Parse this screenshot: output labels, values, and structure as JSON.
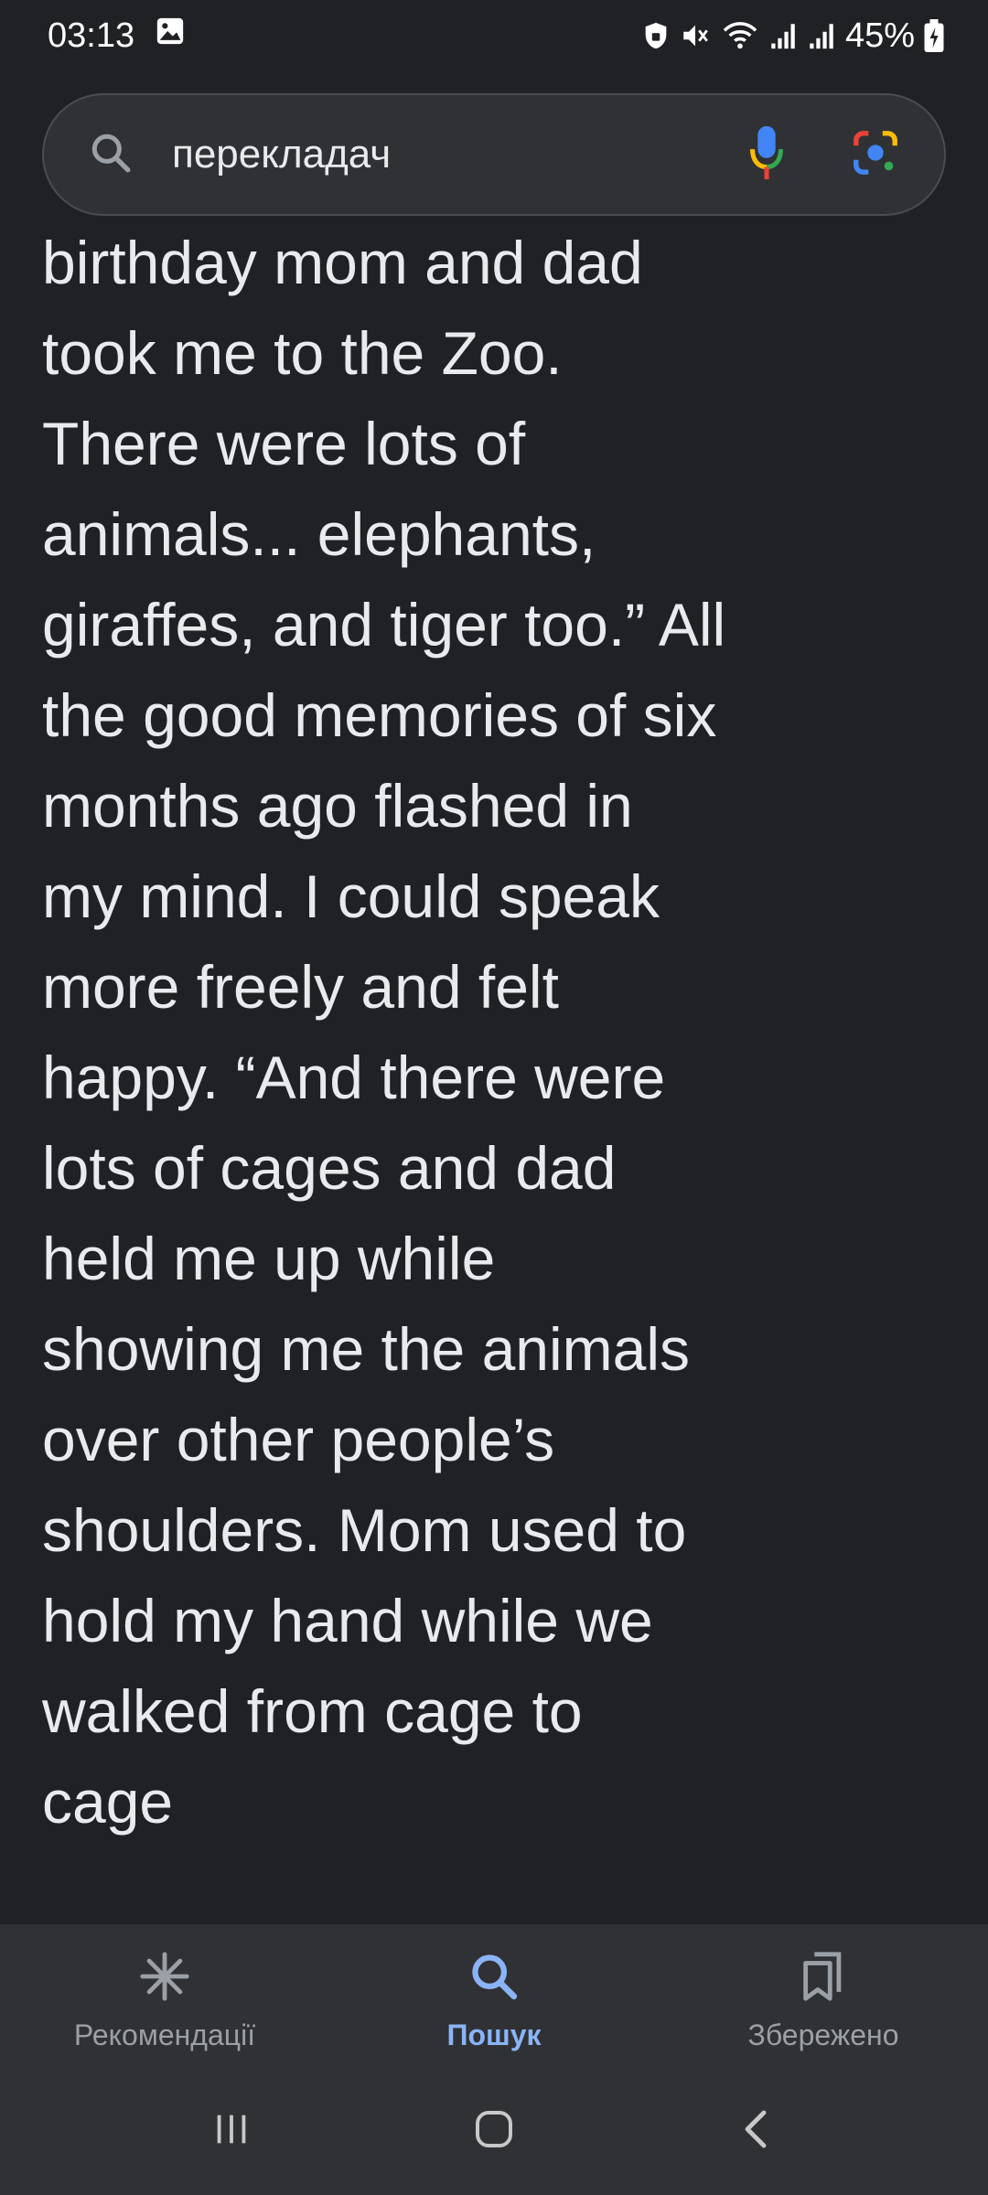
{
  "status_bar": {
    "time": "03:13",
    "battery": "45%",
    "icons": [
      "image-icon",
      "vpn-lock-icon",
      "mute-icon",
      "wifi-icon",
      "signal-icon",
      "signal-icon",
      "battery-charging-icon"
    ]
  },
  "search": {
    "query": "перекладач",
    "icons": [
      "search-icon",
      "mic-icon",
      "lens-icon"
    ]
  },
  "article": {
    "lines": [
      "birthday mom and dad",
      "took me to the Zoo.",
      "There were lots of",
      "animals... elephants,",
      "giraffes, and tiger too.” All",
      "the good memories of six",
      "months ago flashed in",
      "my mind. I could speak",
      "more freely and felt",
      "happy. “And there were",
      "lots of cages and dad",
      "held me up while",
      "showing me the animals",
      "over other people’s",
      "shoulders. Mom used to",
      "hold my hand while we",
      "walked from cage to",
      "cage"
    ]
  },
  "bottom_nav": {
    "items": [
      {
        "label": "Рекомендації",
        "icon": "asterisk-icon",
        "active": false
      },
      {
        "label": "Пошук",
        "icon": "search-icon",
        "active": true
      },
      {
        "label": "Збережено",
        "icon": "bookmarks-icon",
        "active": false
      }
    ]
  },
  "system_nav": [
    "recents-button",
    "home-button",
    "back-button"
  ],
  "colors": {
    "background": "#202124",
    "surface": "#303134",
    "text": "#e8eaed",
    "muted": "#9aa0a6",
    "accent": "#8ab4f8"
  }
}
